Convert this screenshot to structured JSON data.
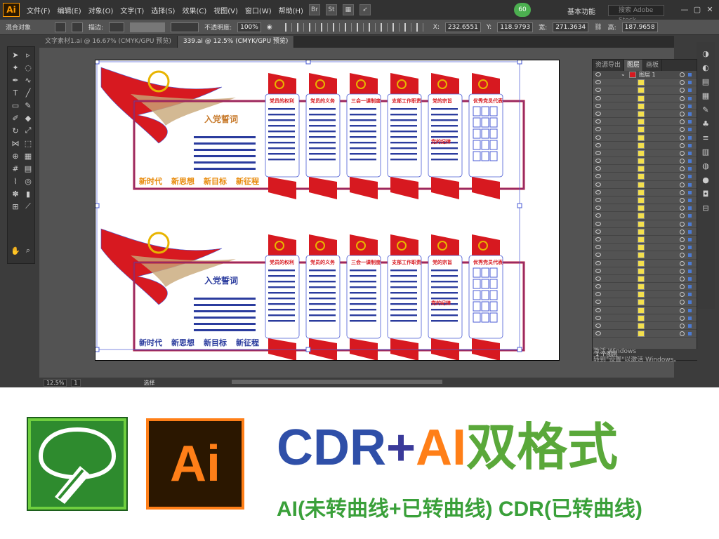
{
  "app": {
    "logo": "Ai"
  },
  "menu": {
    "items": [
      "文件(F)",
      "编辑(E)",
      "对象(O)",
      "文字(T)",
      "选择(S)",
      "效果(C)",
      "视图(V)",
      "窗口(W)",
      "帮助(H)"
    ]
  },
  "menubar_icons": {
    "br": "Br",
    "st": "St"
  },
  "badge": "60",
  "workspace": "基本功能",
  "search": {
    "placeholder": "搜索 Adobe Stock"
  },
  "control_bar": {
    "object_label": "混合对象",
    "stroke_label": "描边:",
    "opacity_label": "不透明度:",
    "opacity_value": "100%",
    "x_label": "X:",
    "x_value": "232.6551",
    "y_label": "Y:",
    "y_value": "118.9793",
    "w_label": "宽:",
    "w_value": "271.3634",
    "h_label": "高:",
    "h_value": "187.9658"
  },
  "tabs": [
    {
      "label": "文字素材1.ai @ 16.67% (CMYK/GPU 预览)"
    },
    {
      "label": "339.ai @ 12.5% (CMYK/GPU 预览)"
    }
  ],
  "layers_panel": {
    "tabs": [
      "资源导出",
      "图层",
      "画板"
    ],
    "layer_name": "图层 1",
    "footer": "1 个图层"
  },
  "status": {
    "zoom": "12.5%",
    "page": "1",
    "tool": "选择"
  },
  "windows_watermark": {
    "line1": "激活 Windows",
    "line2": "转到\"设置\"以激活 Windows。"
  },
  "artwork": {
    "top": {
      "oath_title": "入党誓词",
      "slogan": [
        "新时代",
        "新思想",
        "新目标",
        "新征程"
      ],
      "panels": [
        "党员的权利",
        "党员的义务",
        "三会一课制度",
        "支部工作职责",
        "党的宗旨",
        "优秀党员代表"
      ],
      "extra_heading": "党的纪律"
    },
    "bottom": {
      "oath_title": "入党誓词",
      "slogan": [
        "新时代",
        "新思想",
        "新目标",
        "新征程"
      ],
      "panels": [
        "党员的权利",
        "党员的义务",
        "三会一课制度",
        "支部工作职责",
        "党的宗旨",
        "优秀党员代表"
      ],
      "extra_heading": "党的纪律"
    }
  },
  "banner": {
    "title_cdr": "CDR",
    "title_plus": "+",
    "title_ai": "AI",
    "title_fmt": "双格式",
    "subtitle": "AI(未转曲线+已转曲线) CDR(已转曲线)",
    "ai_logo": "Ai"
  },
  "colors": {
    "party_red": "#d71920",
    "gold": "#e8b400",
    "select_blue": "#4a5bd4",
    "ai_orange": "#ff7f18",
    "cdr_green": "#2e8b2e"
  }
}
